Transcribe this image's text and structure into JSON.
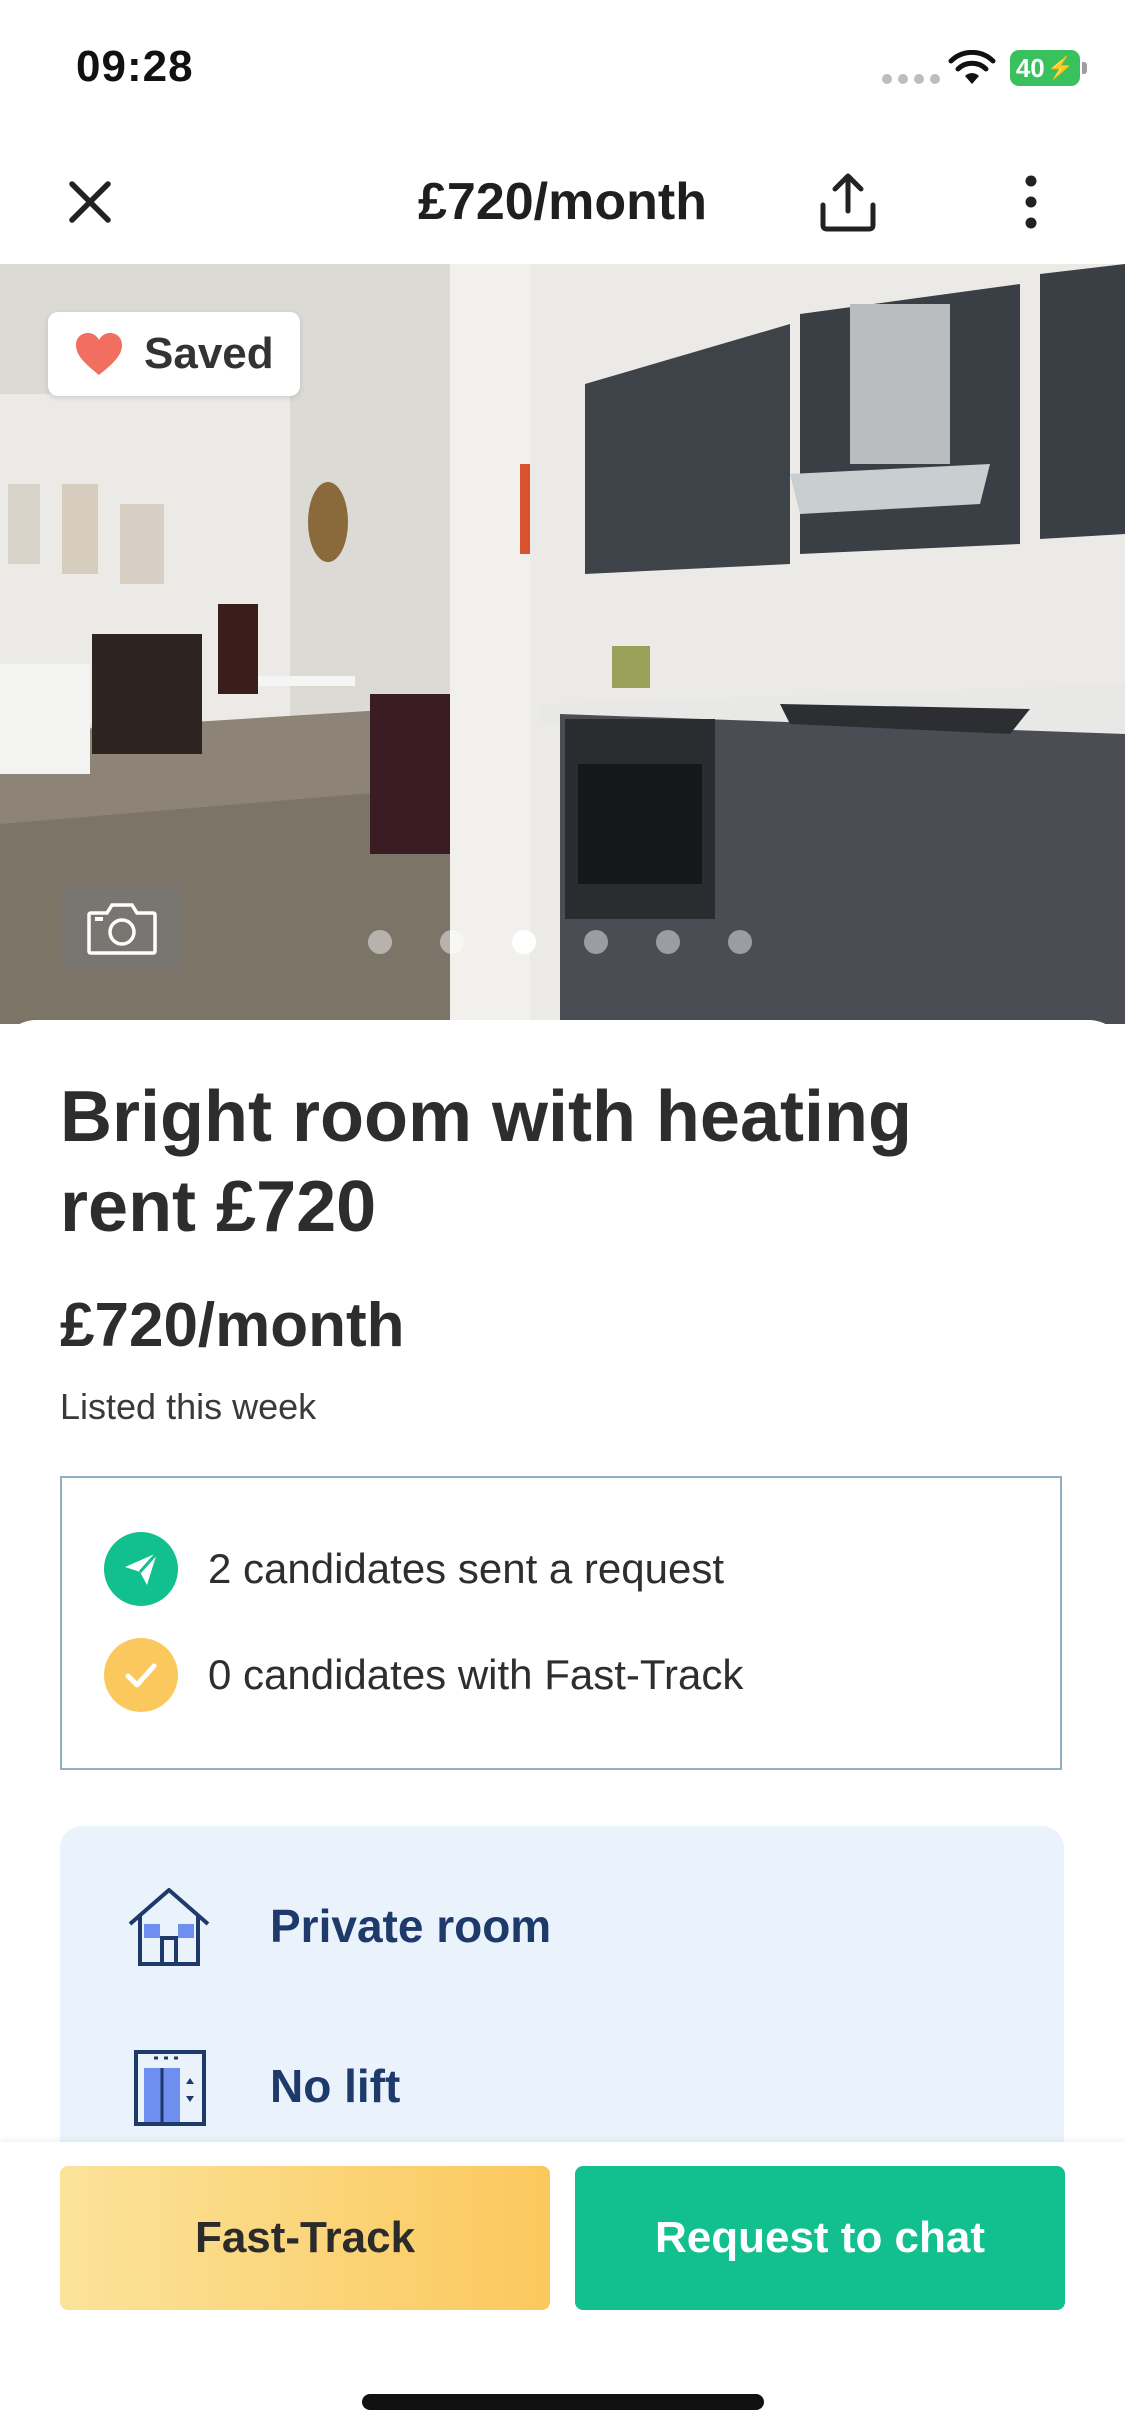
{
  "status_bar": {
    "time": "09:28",
    "battery": "40"
  },
  "nav": {
    "title": "£720/month",
    "icons": [
      "close-icon",
      "share-icon",
      "more-vertical-icon"
    ]
  },
  "photo": {
    "saved_label": "Saved",
    "carousel": {
      "total": 6,
      "active_index": 2
    }
  },
  "listing": {
    "title": "Bright room with heating rent £720",
    "price": "£720/month",
    "listed": "Listed this week"
  },
  "candidates": {
    "requests": "2 candidates sent a request",
    "fast_track": "0 candidates with Fast-Track"
  },
  "features": [
    {
      "label": "Private room",
      "icon": "house-icon"
    },
    {
      "label": "No lift",
      "icon": "lift-icon"
    }
  ],
  "actions": {
    "fast_track": "Fast-Track",
    "chat": "Request to chat"
  },
  "colors": {
    "accent_green": "#12bf8e",
    "fast_track_yellow": "#fbc85d",
    "feature_text": "#1d3a6b",
    "saved_heart": "#f26e61"
  }
}
